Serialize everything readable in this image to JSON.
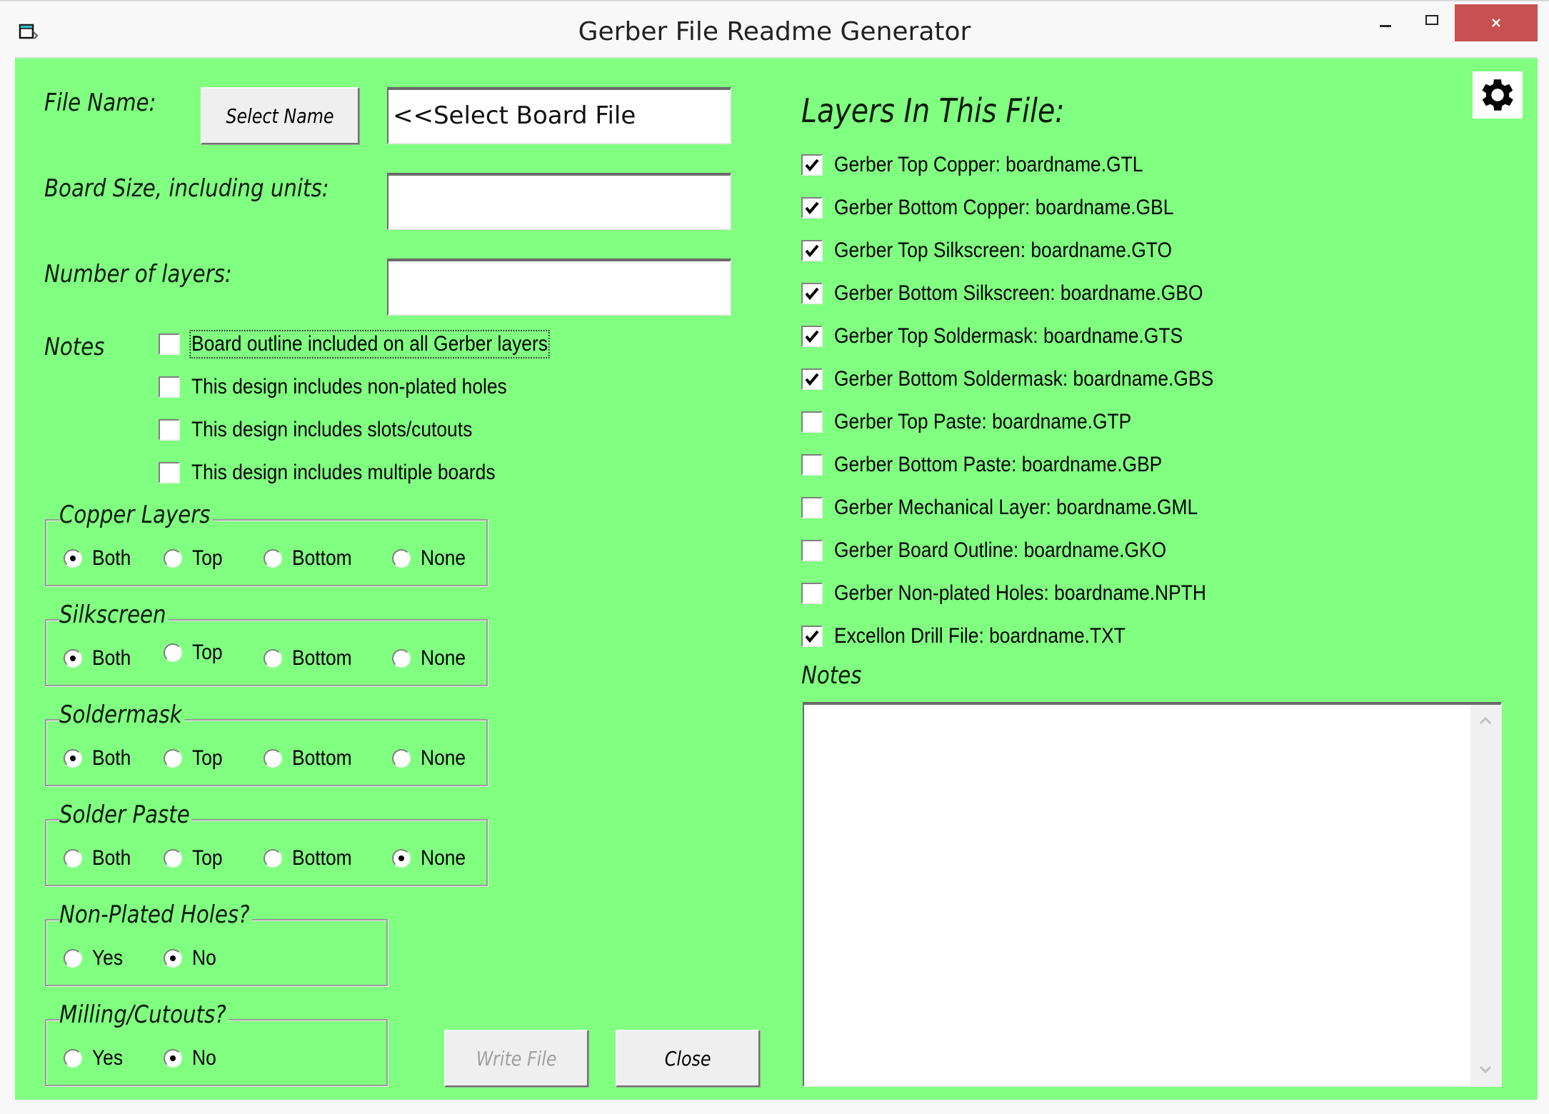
{
  "window": {
    "title": "Gerber File Readme Generator",
    "icons": {
      "app": "app-window-icon",
      "minimize": "minimize-icon",
      "maximize": "maximize-icon",
      "close": "close-icon",
      "settings": "gear-icon"
    }
  },
  "colors": {
    "panel_bg": "#80ff80",
    "close_bg": "#c75050",
    "titlebar_bg": "#f8f8f8"
  },
  "form": {
    "file_name_label": "File Name:",
    "select_name_button": "Select Name",
    "file_name_value": "<<Select Board File",
    "board_size_label": "Board Size, including units:",
    "board_size_value": "",
    "layers_count_label": "Number of layers:",
    "layers_count_value": "",
    "notes_label": "Notes",
    "notes_options": [
      {
        "label": "Board outline included on all Gerber layers",
        "checked": false,
        "focused": true
      },
      {
        "label": "This design includes non-plated holes",
        "checked": false
      },
      {
        "label": "This design includes slots/cutouts",
        "checked": false
      },
      {
        "label": "This design includes multiple boards",
        "checked": false
      }
    ]
  },
  "groups": [
    {
      "title": "Copper Layers",
      "options": [
        "Both",
        "Top",
        "Bottom",
        "None"
      ],
      "selected": "Both"
    },
    {
      "title": "Silkscreen",
      "options": [
        "Both",
        "Top",
        "Bottom",
        "None"
      ],
      "selected": "Both"
    },
    {
      "title": "Soldermask",
      "options": [
        "Both",
        "Top",
        "Bottom",
        "None"
      ],
      "selected": "Both"
    },
    {
      "title": "Solder Paste",
      "options": [
        "Both",
        "Top",
        "Bottom",
        "None"
      ],
      "selected": "None"
    },
    {
      "title": "Non-Plated Holes?",
      "options": [
        "Yes",
        "No"
      ],
      "selected": "No"
    },
    {
      "title": "Milling/Cutouts?",
      "options": [
        "Yes",
        "No"
      ],
      "selected": "No"
    }
  ],
  "buttons": {
    "write_file": "Write File",
    "write_file_enabled": false,
    "close": "Close"
  },
  "layers": {
    "title": "Layers In This File:",
    "items": [
      {
        "label": "Gerber Top Copper: boardname.GTL",
        "checked": true
      },
      {
        "label": "Gerber Bottom Copper: boardname.GBL",
        "checked": true
      },
      {
        "label": "Gerber Top Silkscreen: boardname.GTO",
        "checked": true
      },
      {
        "label": "Gerber Bottom Silkscreen: boardname.GBO",
        "checked": true
      },
      {
        "label": "Gerber Top Soldermask: boardname.GTS",
        "checked": true
      },
      {
        "label": "Gerber Bottom Soldermask: boardname.GBS",
        "checked": true
      },
      {
        "label": "Gerber Top Paste: boardname.GTP",
        "checked": false
      },
      {
        "label": "Gerber Bottom Paste: boardname.GBP",
        "checked": false
      },
      {
        "label": "Gerber Mechanical Layer: boardname.GML",
        "checked": false
      },
      {
        "label": "Gerber Board Outline: boardname.GKO",
        "checked": false
      },
      {
        "label": "Gerber Non-plated Holes: boardname.NPTH",
        "checked": false
      },
      {
        "label": "Excellon Drill File: boardname.TXT",
        "checked": true
      }
    ],
    "notes_label": "Notes",
    "notes_value": ""
  }
}
